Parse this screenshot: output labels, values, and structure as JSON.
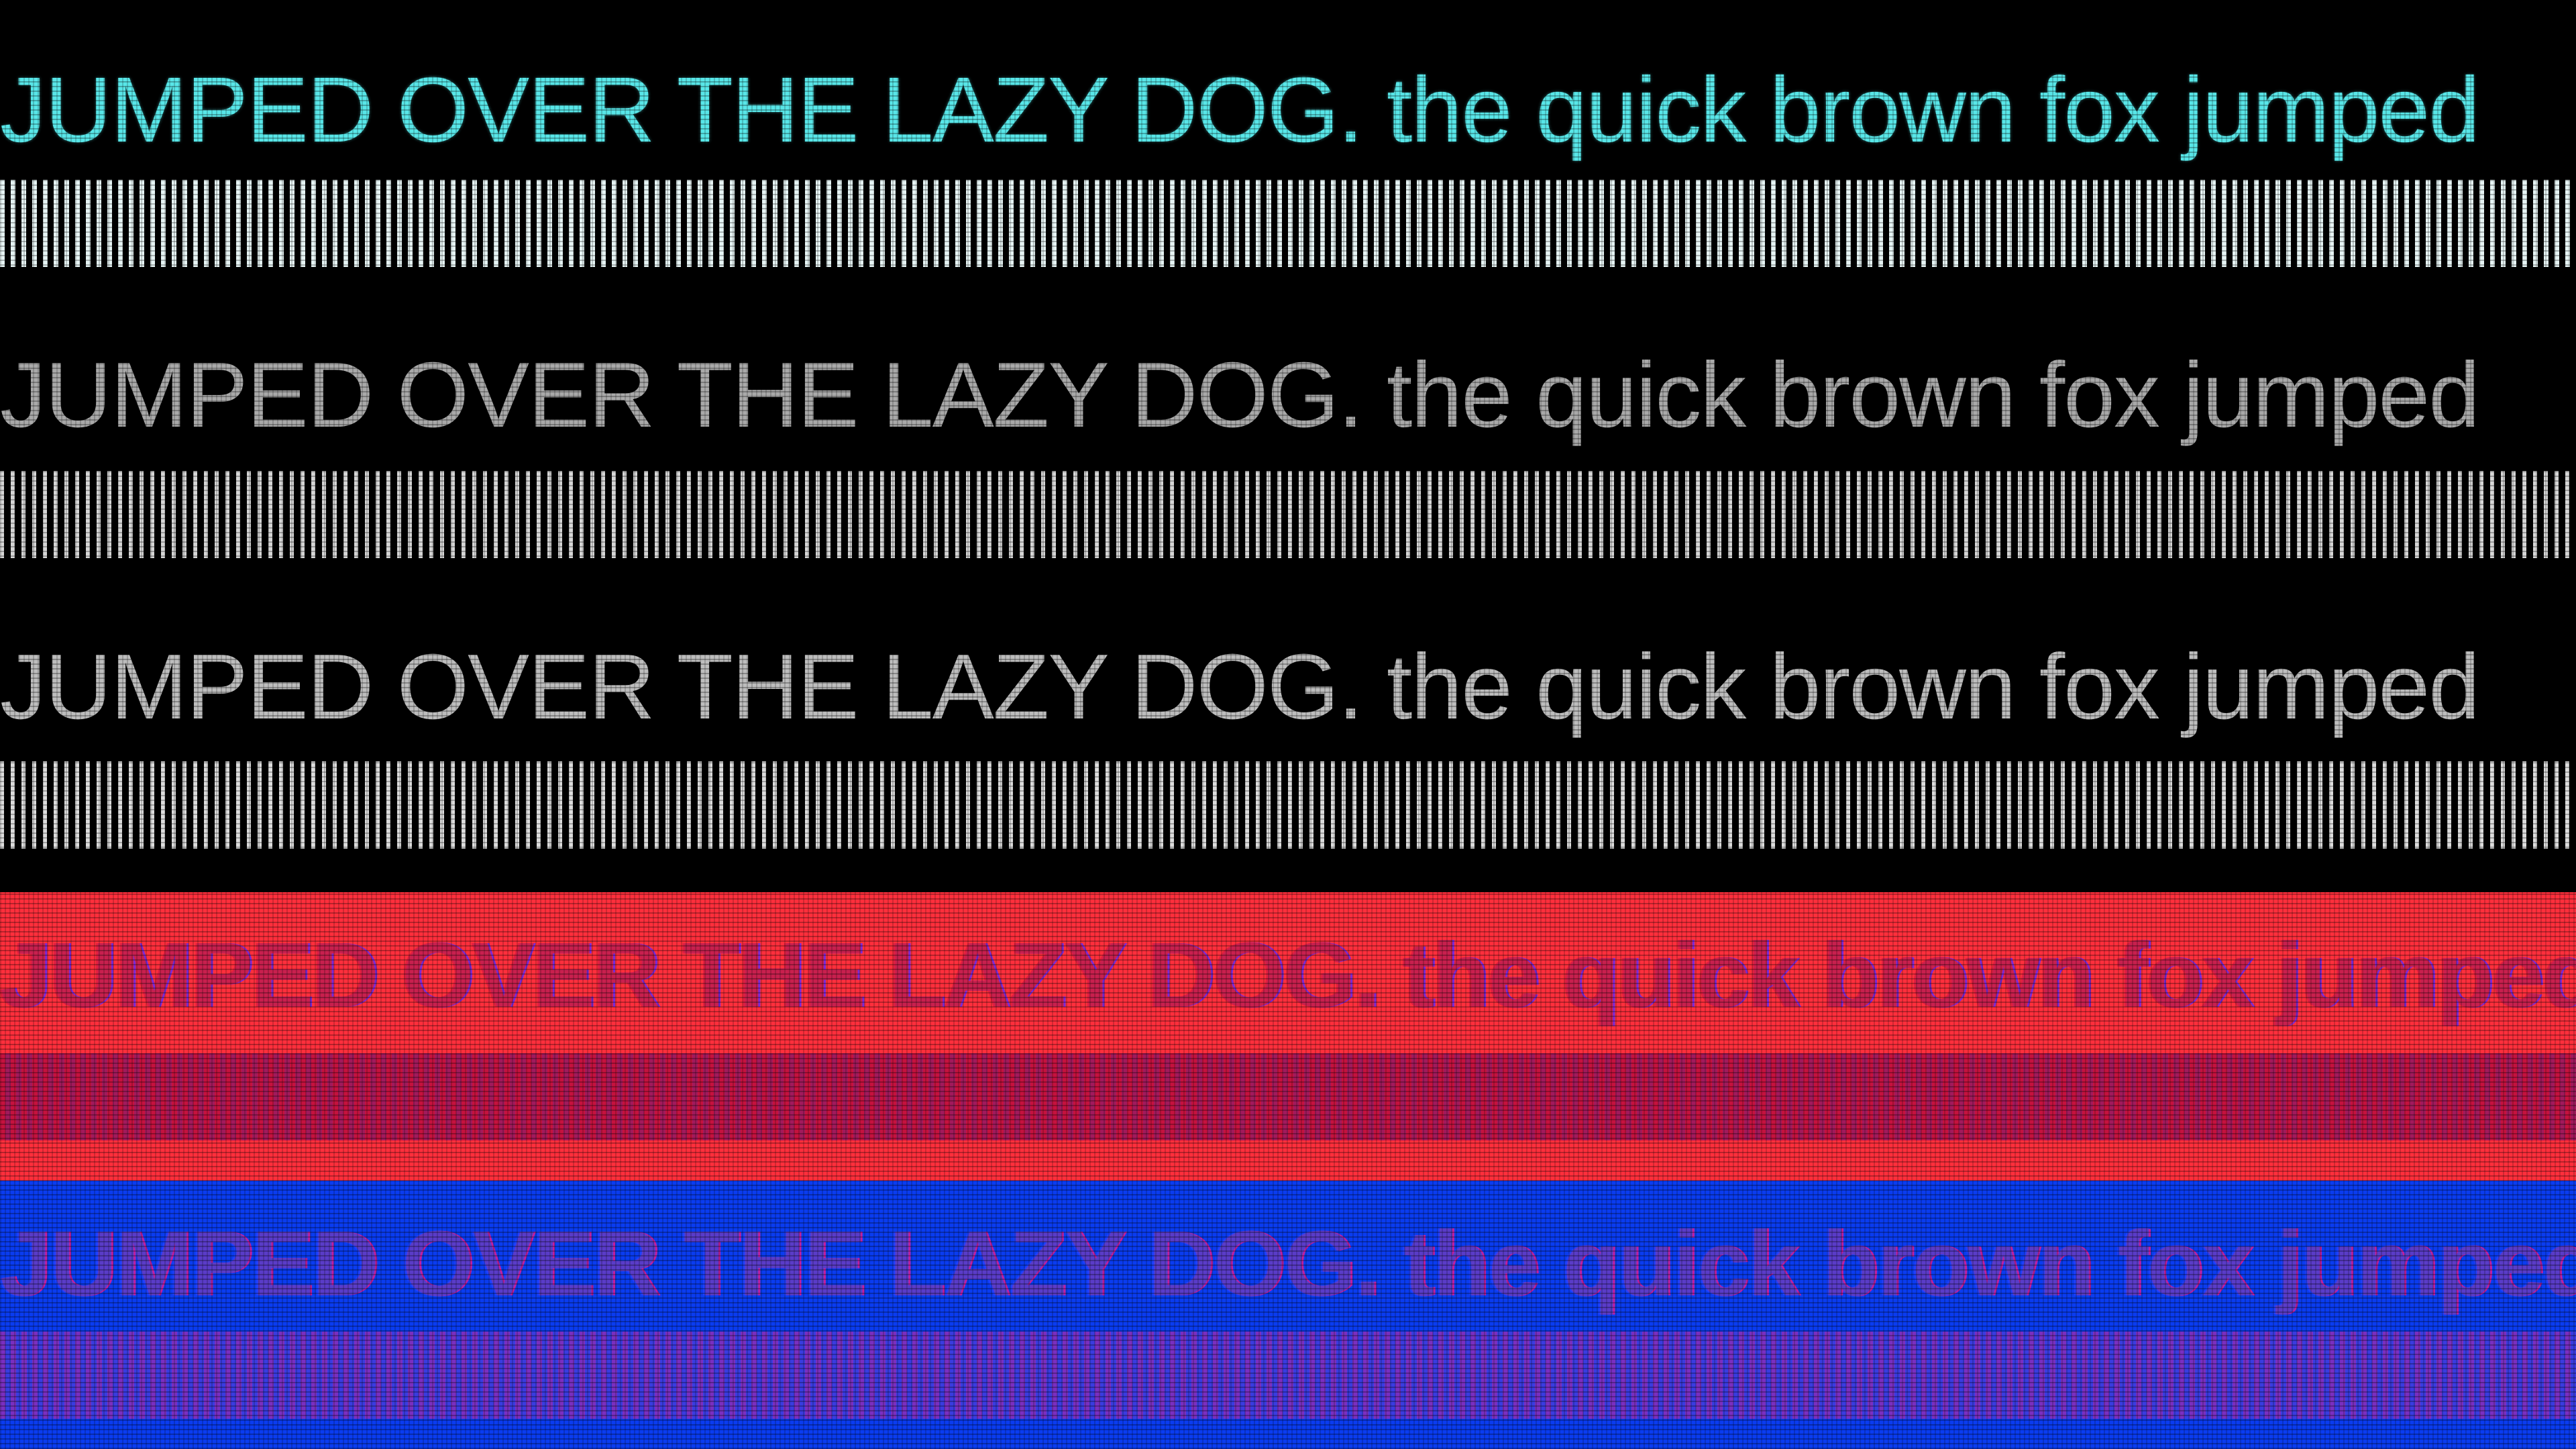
{
  "rows": [
    {
      "text": "JUMPED OVER THE LAZY DOG. the quick brown fox jumped",
      "text_color": "#58e6e8",
      "background": "#000000",
      "stripe_color": "#e6f4f4"
    },
    {
      "text": "JUMPED OVER THE LAZY DOG. the quick brown fox jumped",
      "text_color": "#a9a9a9",
      "background": "#000000",
      "stripe_color": "#d6d6d6"
    },
    {
      "text": "JUMPED OVER THE LAZY DOG. the quick brown fox jumped",
      "text_color": "#bdbdbd",
      "background": "#000000",
      "stripe_color": "#dcdcdc"
    },
    {
      "text": "JUMPED OVER THE LAZY DOG. the quick brown fox jumped",
      "text_color": "#c8204e",
      "background": "#ff2f3c",
      "stripe_color": "#c5123e"
    },
    {
      "text": "JUMPED OVER THE LAZY DOG. the quick brown fox jumped",
      "text_color": "#5a3cc8",
      "background": "#0a3cf0",
      "stripe_color": "#7a2fc0"
    }
  ]
}
